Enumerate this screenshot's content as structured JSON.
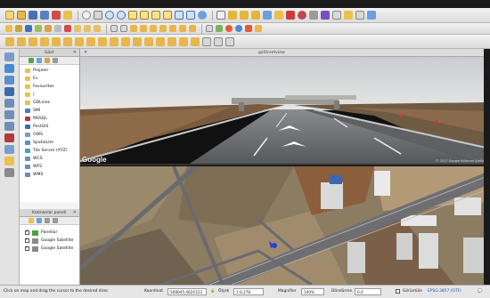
{
  "window": {
    "title": ""
  },
  "panels": {
    "browser": {
      "title": "Göst",
      "items": [
        {
          "label": "Projeler",
          "color": "#e9c14c"
        },
        {
          "label": "Ev",
          "color": "#e9c14c"
        },
        {
          "label": "Favourites",
          "color": "#e9c14c"
        },
        {
          "label": "/",
          "color": "#e9c14c"
        },
        {
          "label": "GDLines",
          "color": "#e9c14c"
        },
        {
          "label": "SMI",
          "color": "#4c7fc2"
        },
        {
          "label": "MSSQL",
          "color": "#b23a3a"
        },
        {
          "label": "PostGIS",
          "color": "#3b6aa8"
        },
        {
          "label": "OWS",
          "color": "#7a9cc9"
        },
        {
          "label": "SpatiaLite",
          "color": "#5a8fcb"
        },
        {
          "label": "Tile Server (XYZ)",
          "color": "#4d9ad3"
        },
        {
          "label": "WCS",
          "color": "#6f8fb8"
        },
        {
          "label": "WFS",
          "color": "#6f8fb8"
        },
        {
          "label": "WMS",
          "color": "#6f8fb8"
        }
      ]
    },
    "layers": {
      "title": "Katmanlar paneli",
      "items": [
        {
          "label": "Panellar",
          "color": "#4aa33a"
        },
        {
          "label": "Google Satellite",
          "color": "#8a8a8a"
        },
        {
          "label": "Google Satellite",
          "color": "#8a8a8a"
        }
      ]
    }
  },
  "map": {
    "street_view_title": "goStreetview",
    "google_label": "Google",
    "copyright": "© 2017 Google   Kullanım Şartları"
  },
  "status_bar": {
    "message": "Click on map and drag the cursor to the desired direc",
    "coord_label": "Koordinat",
    "coord_value": "508045,4624123",
    "scale_label": "Ölçek",
    "scale_value": "1:6,278",
    "magnifier_label": "Magnifier",
    "magnifier_value": "100%",
    "rotation_label": "Döndürme",
    "rotation_value": "0.0",
    "render_label": "Görüntüle",
    "crs_label": "EPSG:3857 (OTF)"
  },
  "colors": {
    "toolbar_bg": "#e6e6e6",
    "selection": "#d9e6f7",
    "road": "#6e6e72",
    "field": "#8a7a5a"
  }
}
